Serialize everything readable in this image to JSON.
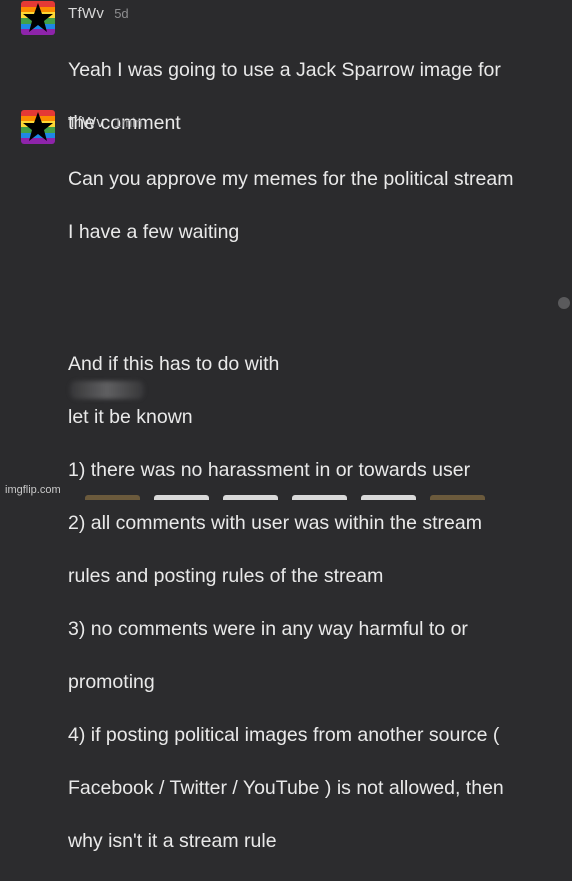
{
  "comments": [
    {
      "username": "TfWv",
      "timestamp": "5d",
      "lines": [
        "Yeah I was going to use a Jack Sparrow image for",
        "the comment"
      ]
    },
    {
      "username": "TfWv",
      "timestamp": "1min",
      "lines": [
        "Can you approve my memes for the political stream",
        "I have a few waiting"
      ],
      "redacted_line_before": "And if this has to do with",
      "redacted_line_after": "let it be known",
      "more_lines": [
        "1) there was no harassment in or towards user",
        "2) all comments with user was within the stream",
        "rules and posting rules of the stream",
        "3) no comments were in any way harmful to or",
        "promoting",
        "4) if posting political images from another source (",
        "Facebook / Twitter / YouTube ) is not allowed, then",
        "why isn't it a stream rule"
      ]
    }
  ],
  "avatar_icon": "rainbow-star-icon",
  "colors": {
    "background": "#2b2b2d",
    "text": "#e9e9e9",
    "muted": "#8e8e90"
  },
  "watermark": "imgflip.com"
}
